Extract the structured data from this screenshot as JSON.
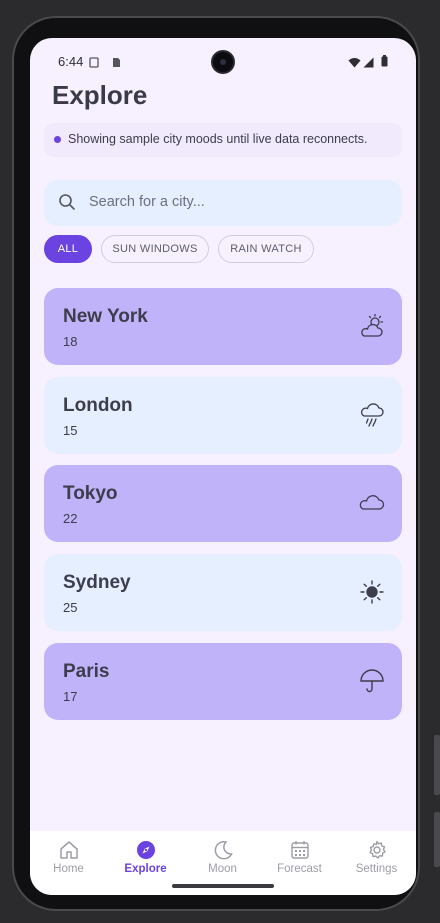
{
  "status_bar": {
    "time": "6:44"
  },
  "header": {
    "title": "Explore"
  },
  "banner": {
    "text": "Showing sample city moods until live data reconnects."
  },
  "search": {
    "placeholder": "Search for a city..."
  },
  "filters": {
    "chips": [
      {
        "label": "ALL",
        "active": true
      },
      {
        "label": "SUN WINDOWS",
        "active": false
      },
      {
        "label": "RAIN WATCH",
        "active": false
      }
    ]
  },
  "cities": [
    {
      "name": "New York",
      "temp": "18",
      "icon": "partly-cloudy-icon",
      "color": "#c0b3fa"
    },
    {
      "name": "London",
      "temp": "15",
      "icon": "rain-cloud-icon",
      "color": "#e6efff"
    },
    {
      "name": "Tokyo",
      "temp": "22",
      "icon": "cloud-icon",
      "color": "#c0b3fa"
    },
    {
      "name": "Sydney",
      "temp": "25",
      "icon": "sun-icon",
      "color": "#e6efff"
    },
    {
      "name": "Paris",
      "temp": "17",
      "icon": "umbrella-icon",
      "color": "#c0b3fa"
    }
  ],
  "nav": {
    "items": [
      {
        "label": "Home",
        "icon": "home-icon"
      },
      {
        "label": "Explore",
        "icon": "compass-icon",
        "active": true
      },
      {
        "label": "Moon",
        "icon": "moon-icon"
      },
      {
        "label": "Forecast",
        "icon": "calendar-icon"
      },
      {
        "label": "Settings",
        "icon": "gear-icon"
      }
    ]
  },
  "colors": {
    "accent": "#6a43e0",
    "card_purple": "#c0b3fa",
    "card_blue": "#e6efff",
    "background": "#f6f0ff"
  }
}
